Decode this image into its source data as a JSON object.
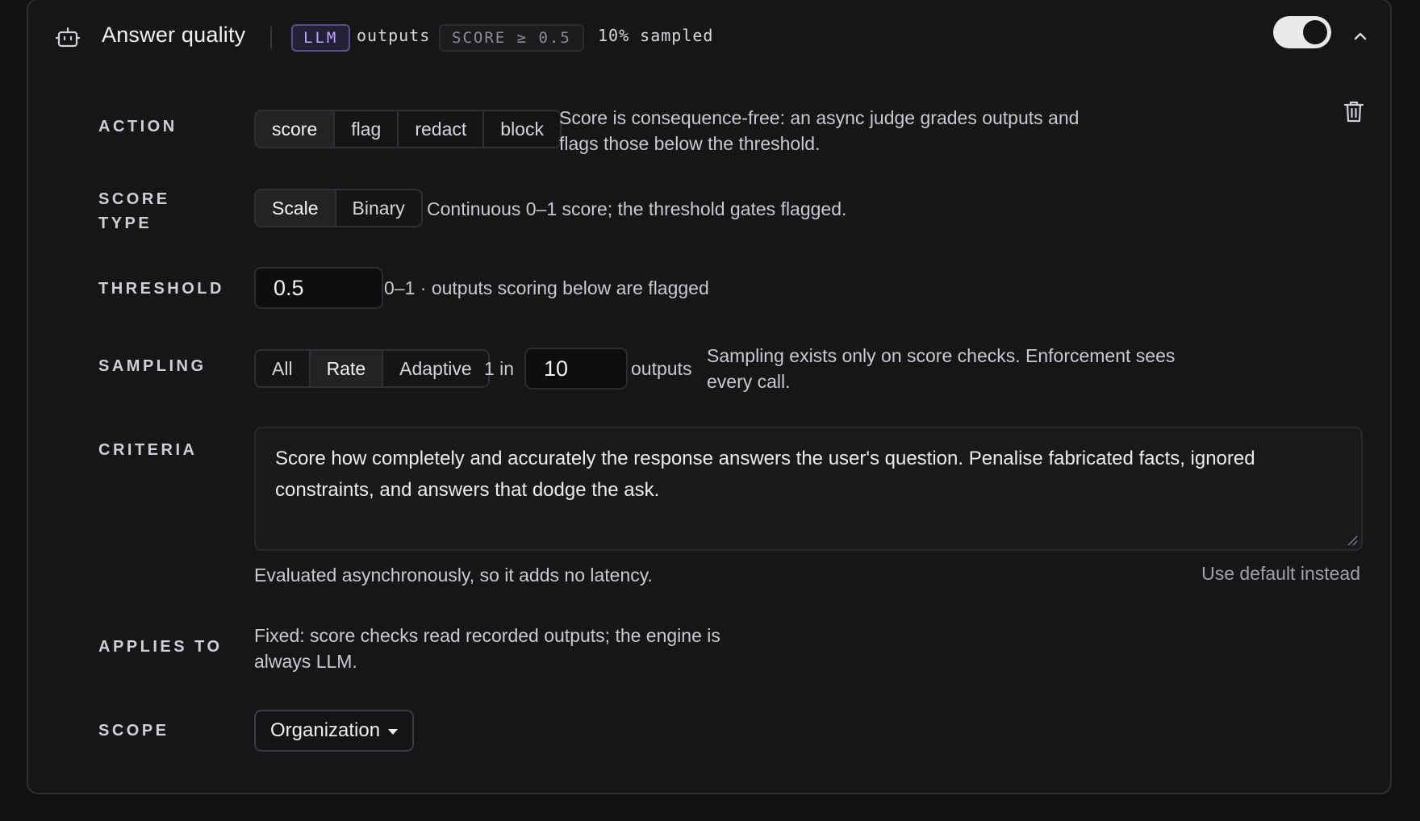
{
  "rule": {
    "title": "Answer quality",
    "engine_badge": "LLM",
    "target": "outputs",
    "threshold_badge": "SCORE ≥ 0.5",
    "sampled_text": "10% sampled",
    "enabled": true
  },
  "action": {
    "label": "ACTION",
    "options": [
      "score",
      "flag",
      "redact",
      "block"
    ],
    "selected": "score",
    "description": "Score is consequence-free: an async judge grades outputs and flags those below the threshold."
  },
  "score_type": {
    "label": "SCORE TYPE",
    "options": [
      "Scale",
      "Binary"
    ],
    "selected": "Scale",
    "description": "Continuous 0–1 score; the threshold gates flagged."
  },
  "threshold": {
    "label": "THRESHOLD",
    "value": "0.5",
    "description": "0–1 · outputs scoring below are flagged"
  },
  "sampling": {
    "label": "SAMPLING",
    "options": [
      "All",
      "Rate",
      "Adaptive"
    ],
    "selected": "Rate",
    "prefix": "1 in",
    "value": "10",
    "suffix": "outputs",
    "description": "Sampling exists only on score checks. Enforcement sees every call."
  },
  "criteria": {
    "label": "CRITERIA",
    "value": "Score how completely and accurately the response answers the user's question. Penalise fabricated facts, ignored constraints, and answers that dodge the ask.",
    "helper": "Evaluated asynchronously, so it adds no latency.",
    "reset_link": "Use default instead"
  },
  "applies_to": {
    "label": "APPLIES TO",
    "description": "Fixed: score checks read recorded outputs; the engine is always LLM."
  },
  "scope": {
    "label": "SCOPE",
    "value": "Organization"
  },
  "icons": {
    "rule_icon": "robot-icon",
    "collapse": "chevron-up-icon",
    "delete": "trash-icon",
    "dropdown": "caret-down-icon"
  },
  "colors": {
    "background": "#111113",
    "card": "#161618",
    "llm_badge_text": "#b9a6ff",
    "llm_badge_border": "#5a4f86",
    "toggle_on": "#e9e9ec"
  }
}
